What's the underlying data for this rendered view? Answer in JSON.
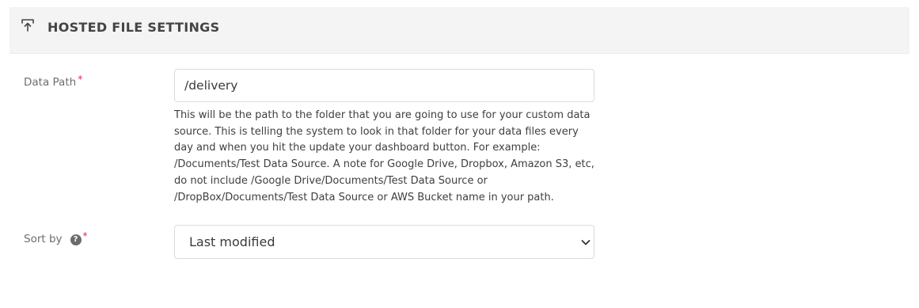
{
  "section": {
    "title": "HOSTED FILE SETTINGS",
    "icon": "upload-icon"
  },
  "fields": {
    "data_path": {
      "label": "Data Path",
      "required_marker": "*",
      "value": "/delivery",
      "help_text": "This will be the path to the folder that you are going to use for your custom data source. This is telling the system to look in that folder for your data files every day and when you hit the update your dashboard button. For example: /Documents/Test Data Source. A note for Google Drive, Dropbox, Amazon S3, etc, do not include /Google Drive/Documents/Test Data Source or /DropBox/Documents/Test Data Source or AWS Bucket name in your path."
    },
    "sort_by": {
      "label": "Sort by",
      "help_icon_glyph": "?",
      "required_marker": "*",
      "selected": "Last modified"
    }
  },
  "colors": {
    "header_bg": "#f4f4f4",
    "required": "#e0245e",
    "border": "#dcdcdc"
  }
}
